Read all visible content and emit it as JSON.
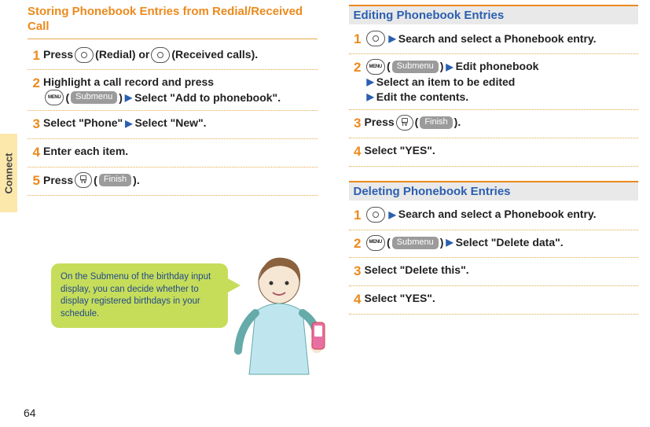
{
  "sidebar": {
    "label": "Connect"
  },
  "page_number": "64",
  "badges": {
    "submenu": "Submenu",
    "finish": "Finish"
  },
  "arrows": {
    "right": "▶"
  },
  "left": {
    "heading": "Storing Phonebook Entries from Redial/Received Call",
    "steps": [
      {
        "num": "1",
        "a": "Press ",
        "b": "(Redial) or ",
        "c": "(Received calls)."
      },
      {
        "num": "2",
        "a": "Highlight a call record and press ",
        "b": "(",
        "c": ")",
        "d": "Select \"Add to phonebook\"."
      },
      {
        "num": "3",
        "a": "Select \"Phone\"",
        "b": "Select \"New\"."
      },
      {
        "num": "4",
        "a": "Enter each item."
      },
      {
        "num": "5",
        "a": "Press ",
        "b": "(",
        "c": ")."
      }
    ],
    "tip": "On the Submenu of the birthday input display, you can decide whether to display registered birthdays in your schedule."
  },
  "right": {
    "edit": {
      "heading": "Editing Phonebook Entries",
      "steps": [
        {
          "num": "1",
          "a": "Search and select a Phonebook entry."
        },
        {
          "num": "2",
          "a": "(",
          "b": ")",
          "c": "Edit phonebook",
          "d": "Select an item to be edited",
          "e": "Edit the contents."
        },
        {
          "num": "3",
          "a": "Press ",
          "b": "(",
          "c": ")."
        },
        {
          "num": "4",
          "a": "Select \"YES\"."
        }
      ]
    },
    "del": {
      "heading": "Deleting Phonebook Entries",
      "steps": [
        {
          "num": "1",
          "a": "Search and select a Phonebook entry."
        },
        {
          "num": "2",
          "a": "(",
          "b": ")",
          "c": "Select \"Delete data\"."
        },
        {
          "num": "3",
          "a": "Select \"Delete this\"."
        },
        {
          "num": "4",
          "a": "Select \"YES\"."
        }
      ]
    }
  }
}
